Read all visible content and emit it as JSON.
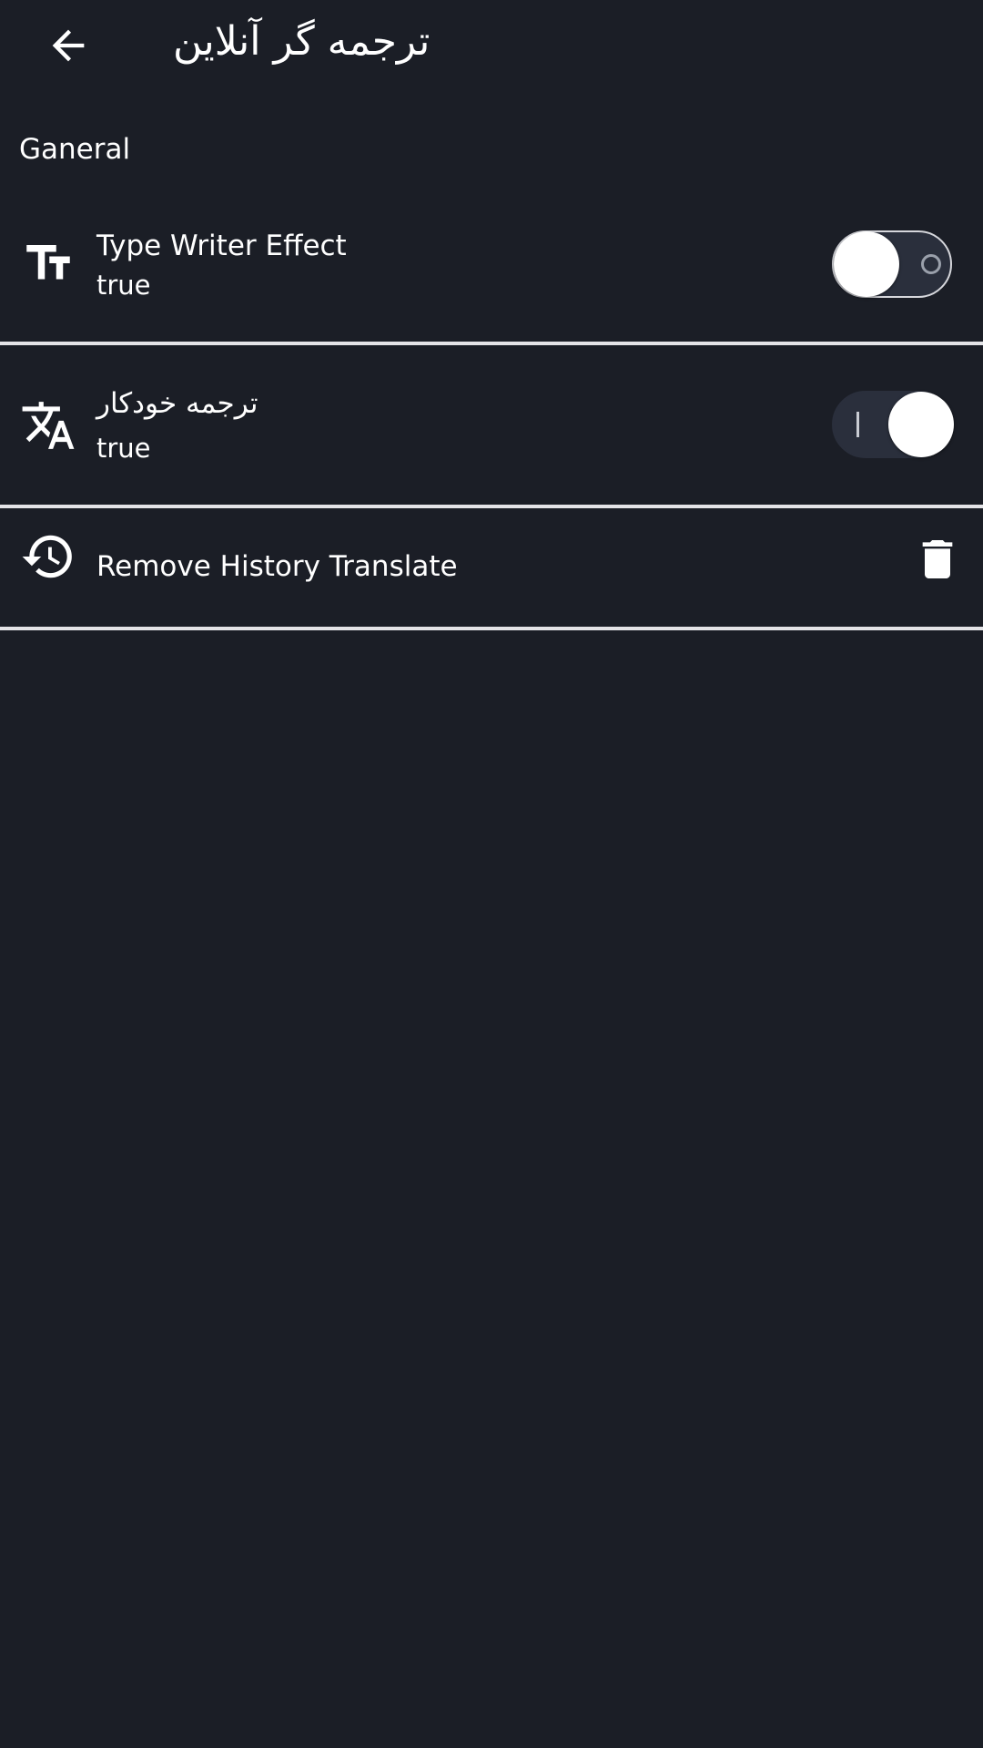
{
  "app_bar": {
    "title": "ترجمه گر آنلاین",
    "back_icon": "arrow-back-icon"
  },
  "section": {
    "header": "Ganeral"
  },
  "preferences": [
    {
      "title": "Type Writer Effect",
      "summary": "true",
      "icon": "text-fields-icon",
      "switch_on": false
    },
    {
      "title": "ترجمه خودکار",
      "summary": "true",
      "icon": "translate-icon",
      "switch_on": true
    },
    {
      "title": "Remove History Translate",
      "icon": "history-icon",
      "action_icon": "trash-icon"
    }
  ],
  "colors": {
    "background": "#1b1e26",
    "text": "#ffffff",
    "divider": "#e4e4e7",
    "switch_track": "#2a2f3c"
  }
}
